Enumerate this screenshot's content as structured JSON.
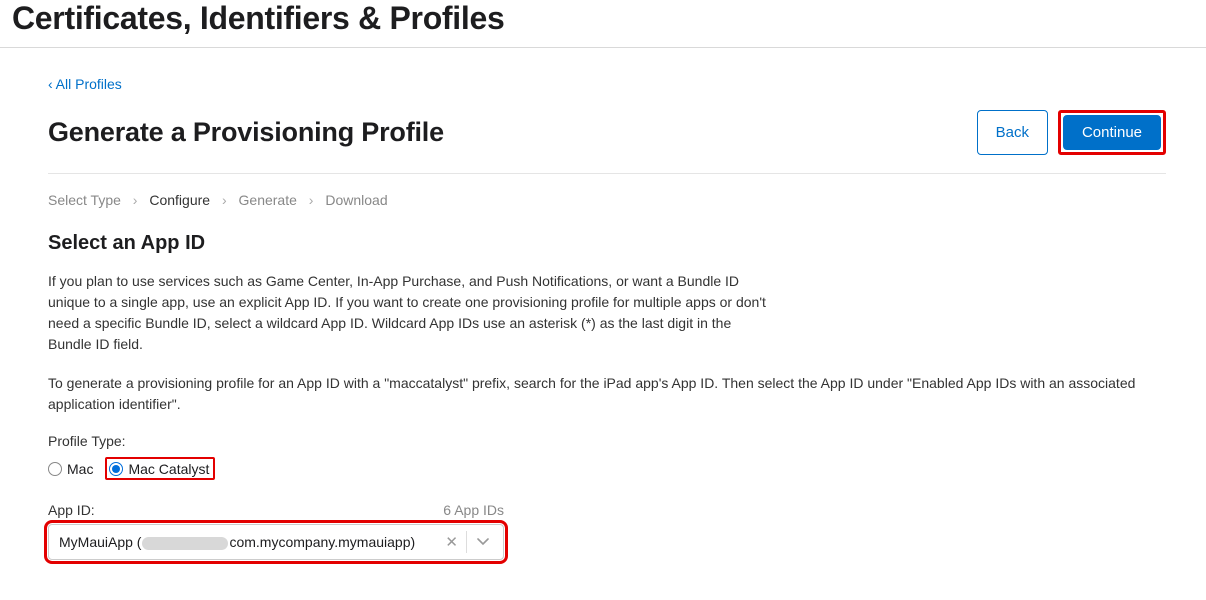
{
  "header": {
    "title": "Certificates, Identifiers & Profiles"
  },
  "breadcrumb": {
    "back_label": "All Profiles"
  },
  "titlebar": {
    "heading": "Generate a Provisioning Profile",
    "back_label": "Back",
    "continue_label": "Continue"
  },
  "steps": {
    "items": [
      {
        "label": "Select Type",
        "active": false
      },
      {
        "label": "Configure",
        "active": true
      },
      {
        "label": "Generate",
        "active": false
      },
      {
        "label": "Download",
        "active": false
      }
    ]
  },
  "section": {
    "heading": "Select an App ID",
    "para1": "If you plan to use services such as Game Center, In-App Purchase, and Push Notifications, or want a Bundle ID unique to a single app, use an explicit App ID. If you want to create one provisioning profile for multiple apps or don't need a specific Bundle ID, select a wildcard App ID. Wildcard App IDs use an asterisk (*) as the last digit in the Bundle ID field.",
    "para2": "To generate a provisioning profile for an App ID with a \"maccatalyst\" prefix, search for the iPad app's App ID. Then select the App ID under \"Enabled App IDs with an associated application identifier\"."
  },
  "profile_type": {
    "label": "Profile Type:",
    "options": [
      {
        "label": "Mac",
        "checked": false
      },
      {
        "label": "Mac Catalyst",
        "checked": true
      }
    ]
  },
  "app_id": {
    "label": "App ID:",
    "count": "6 App IDs",
    "selected_prefix": "MyMauiApp (",
    "selected_suffix": "com.mycompany.mymauiapp)"
  },
  "colors": {
    "accent": "#0070c9",
    "highlight": "#e30000"
  }
}
